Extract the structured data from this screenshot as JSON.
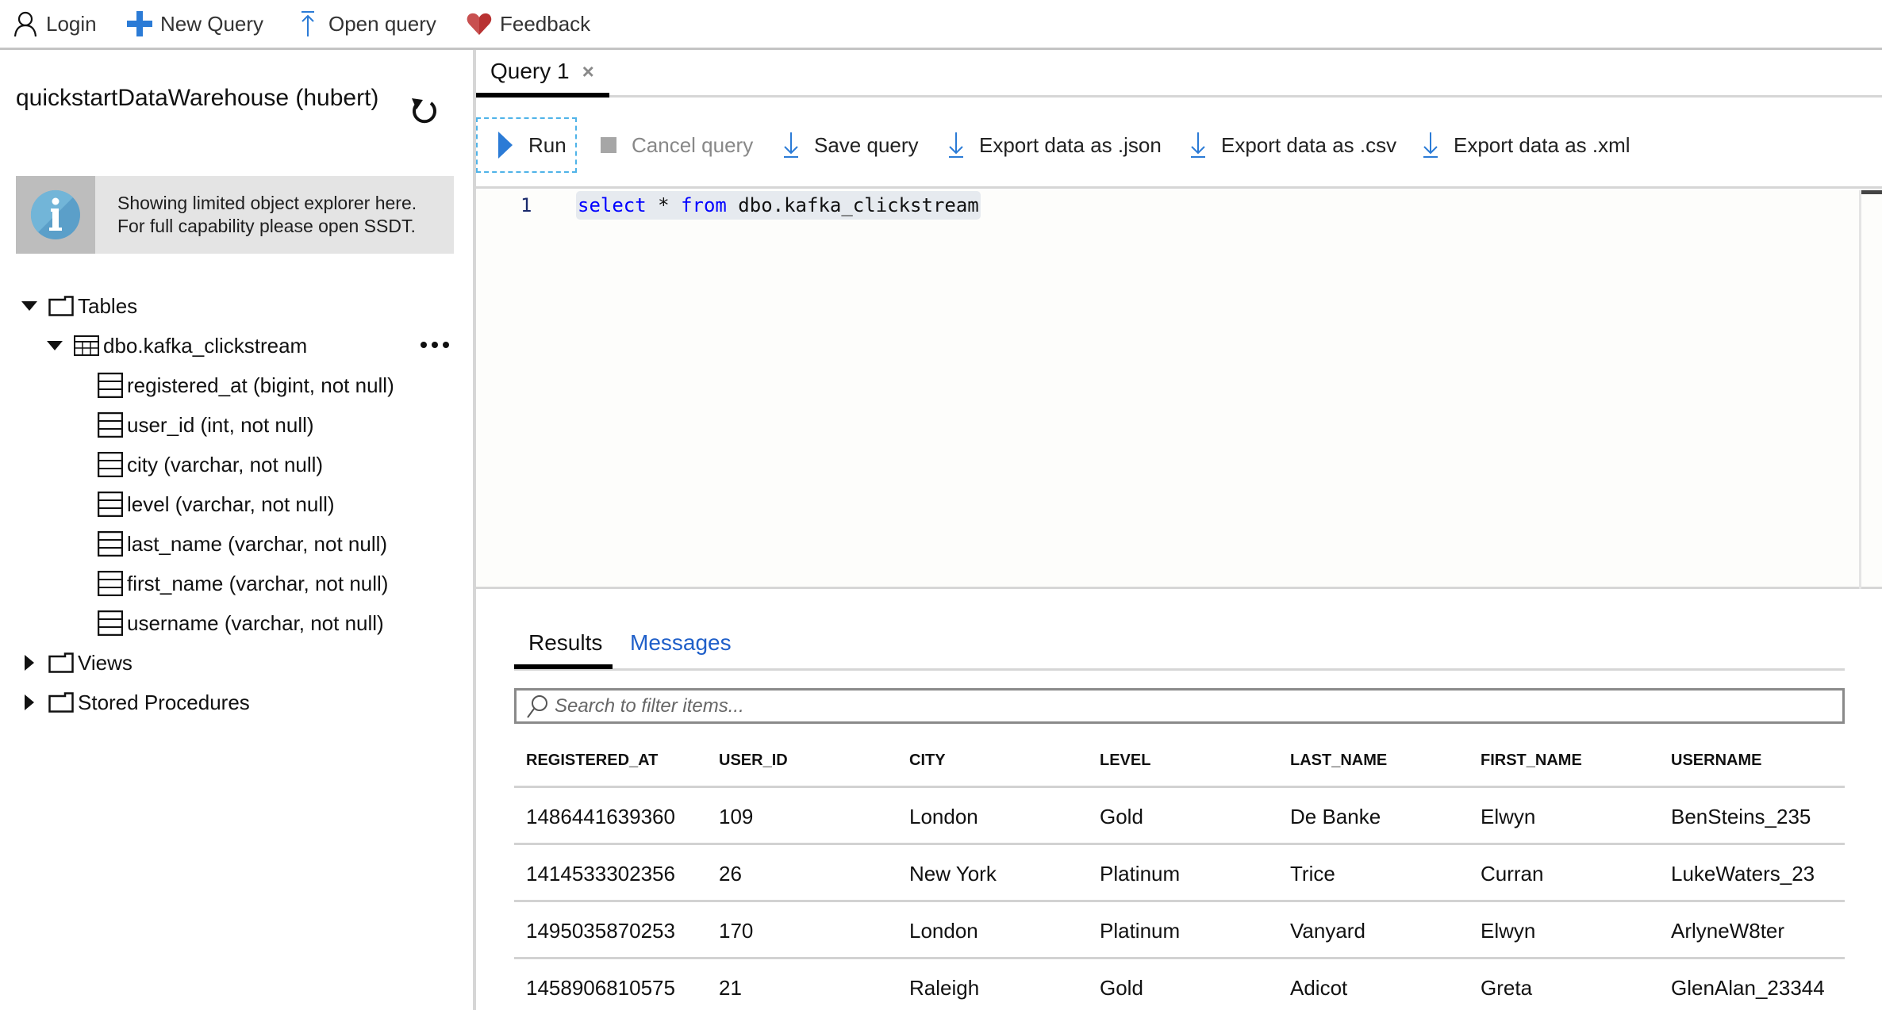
{
  "topbar": {
    "items": [
      {
        "label": "Login",
        "icon": "person-icon"
      },
      {
        "label": "New Query",
        "icon": "plus-icon"
      },
      {
        "label": "Open query",
        "icon": "upload-arrow-icon"
      },
      {
        "label": "Feedback",
        "icon": "heart-icon"
      }
    ]
  },
  "sidebar": {
    "db_title": "quickstartDataWarehouse (hubert)",
    "refresh_icon": "refresh-icon",
    "info": {
      "line1": "Showing limited object explorer here.",
      "line2": "For full capability please open SSDT."
    },
    "tree": {
      "tables": "Tables",
      "table_name": "dbo.kafka_clickstream",
      "columns": [
        "registered_at (bigint, not null)",
        "user_id (int, not null)",
        "city (varchar, not null)",
        "level (varchar, not null)",
        "last_name (varchar, not null)",
        "first_name (varchar, not null)",
        "username (varchar, not null)"
      ],
      "views": "Views",
      "stored_procedures": "Stored Procedures"
    }
  },
  "editor_tab": {
    "label": "Query 1",
    "close": "×"
  },
  "toolbar": {
    "run": "Run",
    "cancel": "Cancel query",
    "save": "Save query",
    "export_json": "Export data as .json",
    "export_csv": "Export data as .csv",
    "export_xml": "Export data as .xml"
  },
  "editor": {
    "line_number": "1",
    "code": {
      "kw1": "select",
      "op": " * ",
      "kw2": "from",
      "rest": " dbo.kafka_clickstream"
    }
  },
  "results": {
    "tabs": {
      "results": "Results",
      "messages": "Messages"
    },
    "search_placeholder": "Search to filter items...",
    "columns": [
      "REGISTERED_AT",
      "USER_ID",
      "CITY",
      "LEVEL",
      "LAST_NAME",
      "FIRST_NAME",
      "USERNAME"
    ],
    "rows": [
      [
        "1486441639360",
        "109",
        "London",
        "Gold",
        "De Banke",
        "Elwyn",
        "BenSteins_235"
      ],
      [
        "1414533302356",
        "26",
        "New York",
        "Platinum",
        "Trice",
        "Curran",
        "LukeWaters_23"
      ],
      [
        "1495035870253",
        "170",
        "London",
        "Platinum",
        "Vanyard",
        "Elwyn",
        "ArlyneW8ter"
      ],
      [
        "1458906810575",
        "21",
        "Raleigh",
        "Gold",
        "Adicot",
        "Greta",
        "GlenAlan_23344"
      ]
    ]
  },
  "colors": {
    "accent_blue": "#2b7bd6",
    "link_blue": "#1f5fc9",
    "keyword_blue": "#0000ff",
    "heart_red": "#b83232",
    "run_focus": "#4fb3e8"
  }
}
